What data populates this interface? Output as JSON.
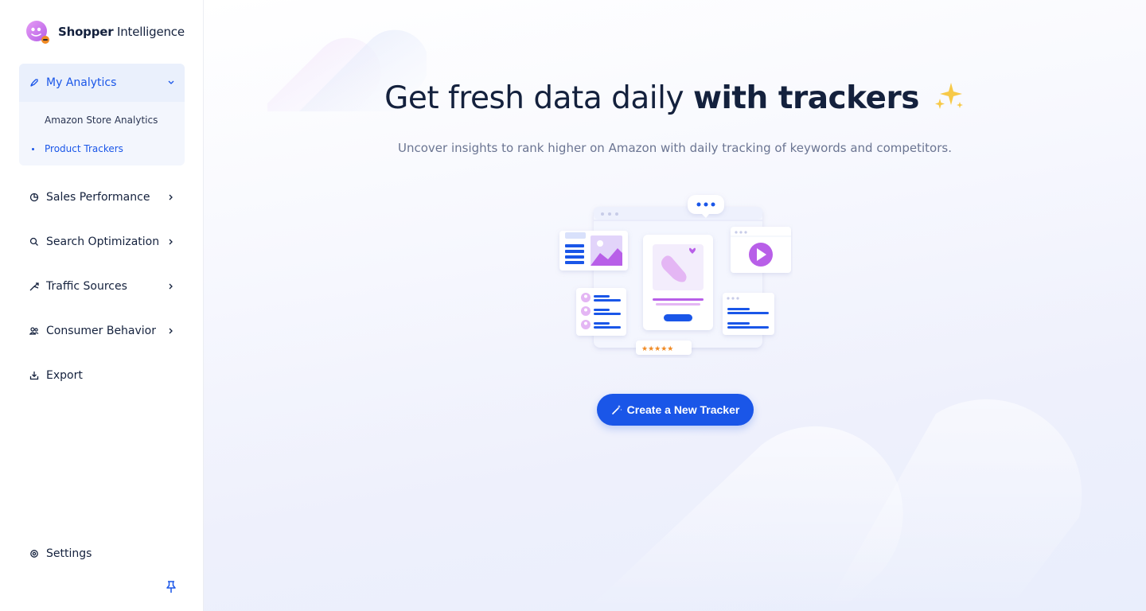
{
  "brand": {
    "name_bold": "Shopper",
    "name_rest": " Intelligence"
  },
  "sidebar": {
    "group": {
      "label": "My Analytics",
      "icon": "rocket-icon",
      "items": [
        {
          "label": "Amazon Store Analytics",
          "active": false
        },
        {
          "label": "Product Trackers",
          "active": true
        }
      ]
    },
    "items": [
      {
        "label": "Sales Performance",
        "icon": "pie-chart-icon"
      },
      {
        "label": "Search Optimization",
        "icon": "search-icon"
      },
      {
        "label": "Traffic Sources",
        "icon": "traffic-icon"
      },
      {
        "label": "Consumer Behavior",
        "icon": "users-icon"
      },
      {
        "label": "Export",
        "icon": "download-icon"
      }
    ],
    "settings": {
      "label": "Settings",
      "icon": "gear-icon"
    },
    "pin_icon": "pin-icon"
  },
  "hero": {
    "title_regular": "Get fresh data daily ",
    "title_bold": "with trackers",
    "sparkle_icon": "sparkles-icon",
    "subtitle": "Uncover insights to rank higher on Amazon with daily tracking of keywords and competitors.",
    "cta_label": "Create a New Tracker",
    "cta_icon": "magic-wand-icon"
  },
  "colors": {
    "accent": "#1a56e8",
    "purple": "#b85fe8",
    "text": "#14213d",
    "muted": "#6b7592"
  }
}
